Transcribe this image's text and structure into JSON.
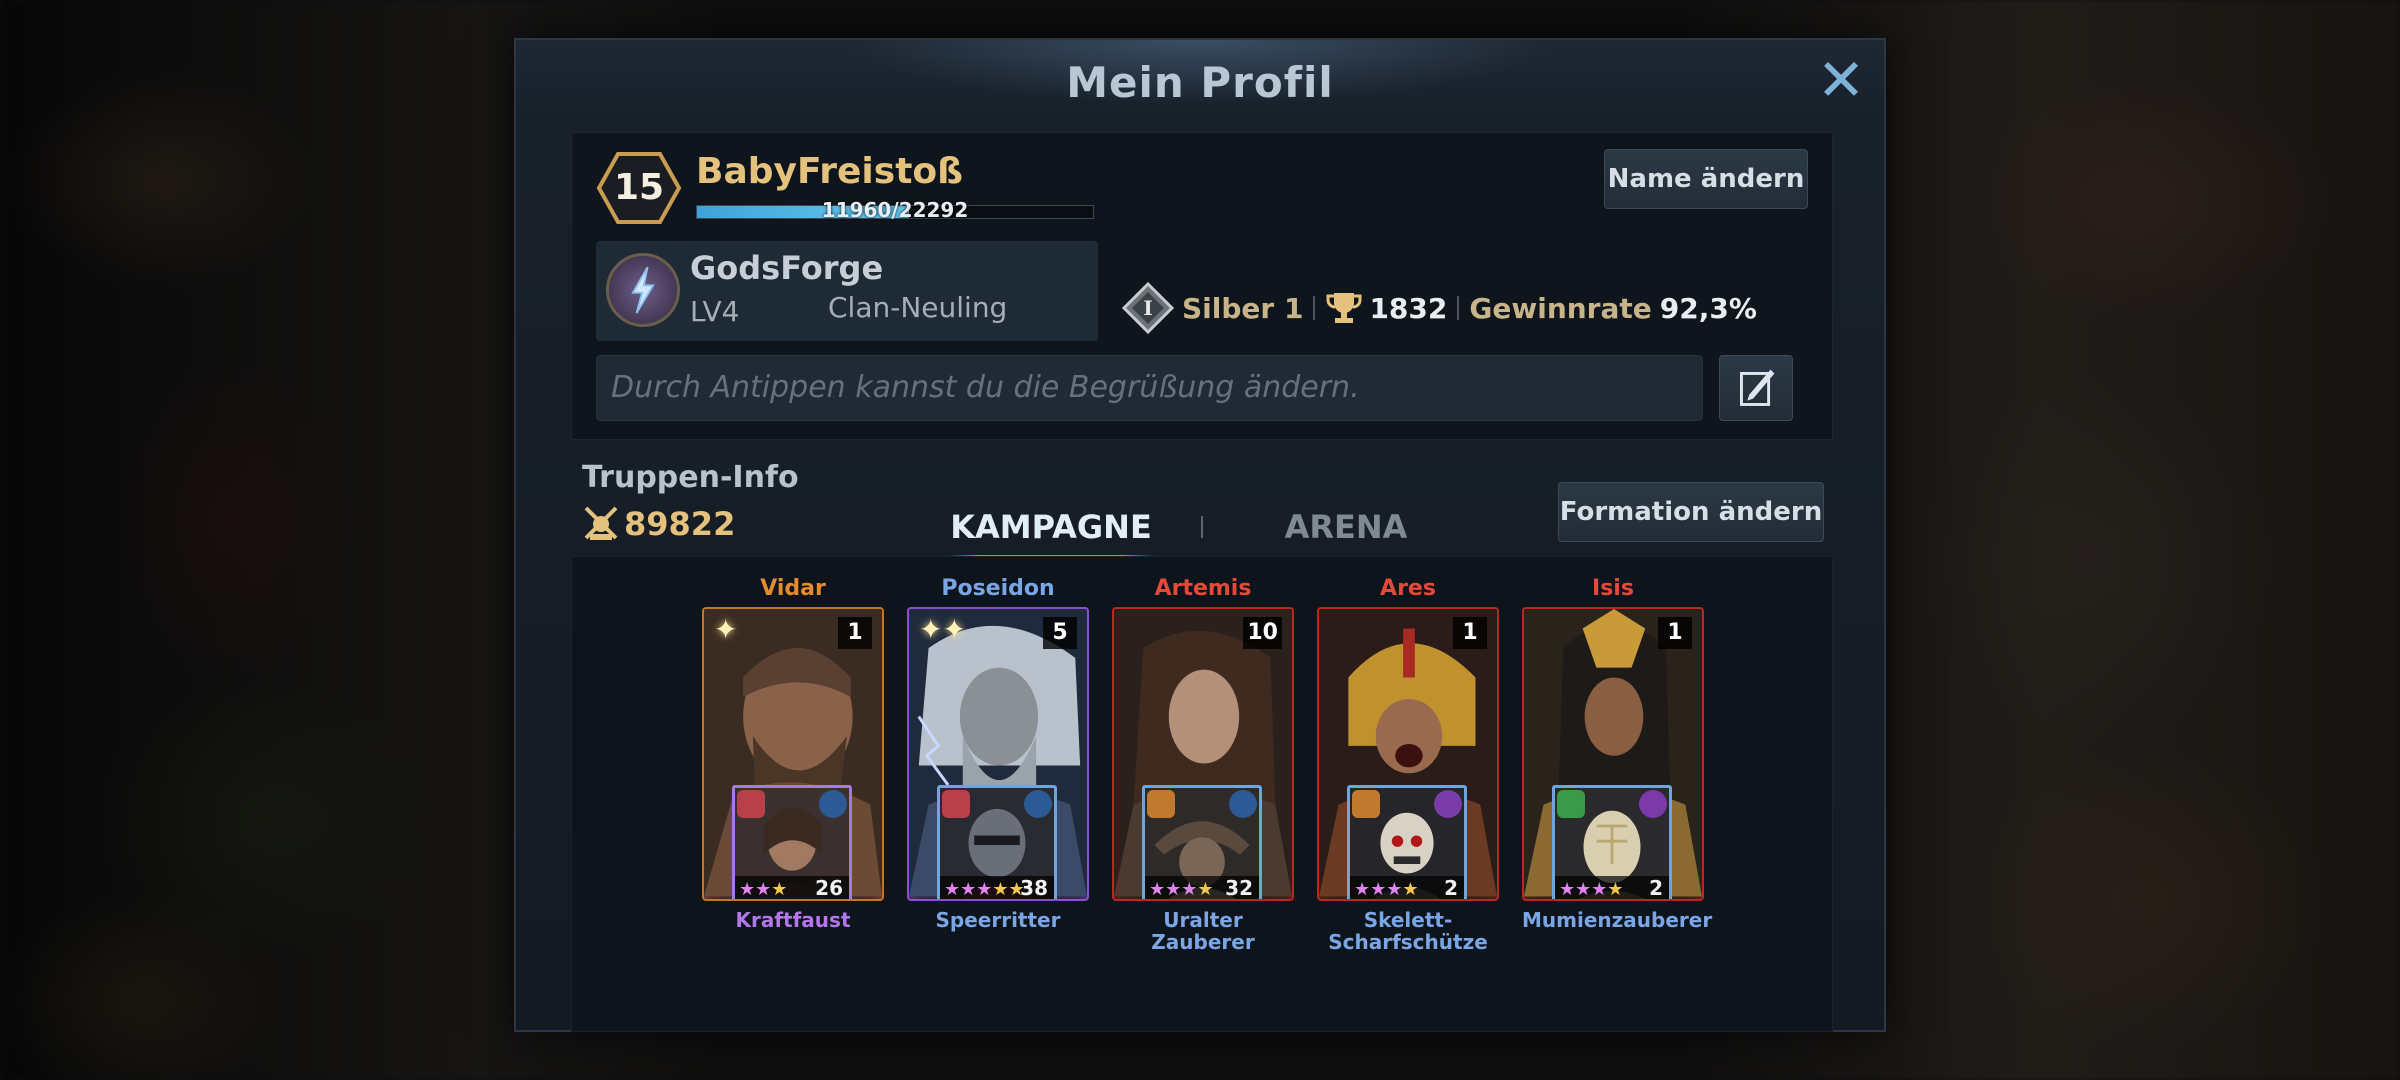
{
  "dialog": {
    "title": "Mein Profil"
  },
  "profile": {
    "level": "15",
    "name": "BabyFreistoß",
    "xp_text": "11960/22292",
    "xp_fraction": 0.5365,
    "rename_button": "Name ändern",
    "clan": {
      "name": "GodsForge",
      "level": "LV4",
      "rank": "Clan-Neuling"
    },
    "arena_rank": "Silber 1",
    "trophies": "1832",
    "winrate_label": "Gewinnrate",
    "winrate_value": "92,3%",
    "greeting_placeholder": "Durch Antippen kannst du die Begrüßung ändern."
  },
  "troops": {
    "label": "Truppen-Info",
    "power": "89822",
    "tabs": {
      "campaign": "KAMPAGNE",
      "arena": "ARENA"
    },
    "formation_button": "Formation ändern"
  },
  "heroes": [
    {
      "name": "Vidar",
      "name_color": "#e68a2e",
      "stars": "✦",
      "level": "1",
      "unit_name": "Kraftfaust",
      "unit_name_color": "#b277e8",
      "unit_stars_pink": "★★",
      "unit_stars_gold": "★",
      "unit_count": "26"
    },
    {
      "name": "Poseidon",
      "name_color": "#7aa6e6",
      "stars": "✦✦",
      "level": "5",
      "unit_name": "Speerritter",
      "unit_name_color": "#7aa6e6",
      "unit_stars_pink": "★★★",
      "unit_stars_gold": "★★",
      "unit_count": "38"
    },
    {
      "name": "Artemis",
      "name_color": "#e34a3a",
      "stars": "",
      "level": "10",
      "unit_name": "Uralter Zauberer",
      "unit_name_color": "#7aa6e6",
      "unit_stars_pink": "★★★",
      "unit_stars_gold": "★",
      "unit_count": "32"
    },
    {
      "name": "Ares",
      "name_color": "#e34a3a",
      "stars": "",
      "level": "1",
      "unit_name": "Skelett-Scharfschütze",
      "unit_name_color": "#7aa6e6",
      "unit_stars_pink": "★★★",
      "unit_stars_gold": "★",
      "unit_count": "2"
    },
    {
      "name": "Isis",
      "name_color": "#e34a3a",
      "stars": "",
      "level": "1",
      "unit_name": "Mumienzauberer",
      "unit_name_color": "#7aa6e6",
      "unit_stars_pink": "★★★",
      "unit_stars_gold": "★",
      "unit_count": "2"
    }
  ]
}
